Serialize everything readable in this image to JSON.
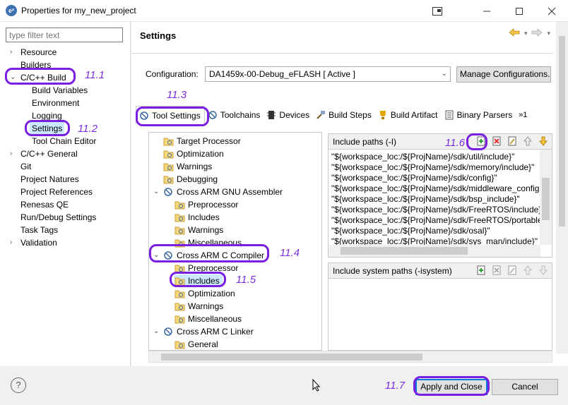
{
  "window": {
    "title": "Properties for my_new_project",
    "icon_name": "eclipse-e2-icon"
  },
  "left": {
    "filter_placeholder": "type filter text",
    "items": [
      {
        "label": "Resource",
        "expandable": true
      },
      {
        "label": "Builders"
      },
      {
        "label": "C/C++ Build",
        "expanded": true
      },
      {
        "label": "Build Variables",
        "child": true
      },
      {
        "label": "Environment",
        "child": true
      },
      {
        "label": "Logging",
        "child": true
      },
      {
        "label": "Settings",
        "child": true,
        "selected": true
      },
      {
        "label": "Tool Chain Editor",
        "child": true
      },
      {
        "label": "C/C++ General",
        "expandable": true
      },
      {
        "label": "Git"
      },
      {
        "label": "Project Natures"
      },
      {
        "label": "Project References"
      },
      {
        "label": "Renesas QE"
      },
      {
        "label": "Run/Debug Settings"
      },
      {
        "label": "Task Tags"
      },
      {
        "label": "Validation",
        "expandable": true
      }
    ]
  },
  "right": {
    "title": "Settings",
    "config_label": "Configuration:",
    "config_value": "DA1459x-00-Debug_eFLASH  [ Active ]",
    "manage_button": "Manage Configurations...",
    "tabs": [
      "Tool Settings",
      "Toolchains",
      "Devices",
      "Build Steps",
      "Build Artifact",
      "Binary Parsers",
      "»1"
    ],
    "tree": [
      {
        "label": "Target Processor",
        "level": 1
      },
      {
        "label": "Optimization",
        "level": 1
      },
      {
        "label": "Warnings",
        "level": 1
      },
      {
        "label": "Debugging",
        "level": 1
      },
      {
        "label": "Cross ARM GNU Assembler",
        "level": 0
      },
      {
        "label": "Preprocessor",
        "level": 2
      },
      {
        "label": "Includes",
        "level": 2
      },
      {
        "label": "Warnings",
        "level": 2
      },
      {
        "label": "Miscellaneous",
        "level": 2
      },
      {
        "label": "Cross ARM C Compiler",
        "level": 0
      },
      {
        "label": "Preprocessor",
        "level": 2
      },
      {
        "label": "Includes",
        "level": 2,
        "selected": true
      },
      {
        "label": "Optimization",
        "level": 2
      },
      {
        "label": "Warnings",
        "level": 2
      },
      {
        "label": "Miscellaneous",
        "level": 2
      },
      {
        "label": "Cross ARM C Linker",
        "level": 0
      },
      {
        "label": "General",
        "level": 2
      }
    ],
    "include_paths_title": "Include paths (-I)",
    "include_paths": [
      "\"${workspace_loc:/${ProjName}/sdk/util/include}\"",
      "\"${workspace_loc:/${ProjName}/sdk/memory/include}\"",
      "\"${workspace_loc:/${ProjName}/sdk/config}\"",
      "\"${workspace_loc:/${ProjName}/sdk/middleware_config",
      "\"${workspace_loc:/${ProjName}/sdk/bsp_include}\"",
      "\"${workspace_loc:/${ProjName}/sdk/FreeRTOS/include}",
      "\"${workspace_loc:/${ProjName}/sdk/FreeRTOS/portable",
      "\"${workspace_loc:/${ProjName}/sdk/osal}\"",
      "\"${workspace_loc:/${ProjName}/sdk/sys_man/include}\""
    ],
    "system_paths_title": "Include system paths (-isystem)"
  },
  "footer": {
    "help": "?",
    "apply_close": "Apply and Close",
    "cancel": "Cancel"
  },
  "annotations": {
    "a1": "11.1",
    "a2": "11.2",
    "a3": "11.3",
    "a4": "11.4",
    "a5": "11.5",
    "a6": "11.6",
    "a7": "11.7"
  },
  "colors": {
    "annotation": "#7a1fe0",
    "selection": "#cce8ff",
    "accent": "#0078d7"
  }
}
